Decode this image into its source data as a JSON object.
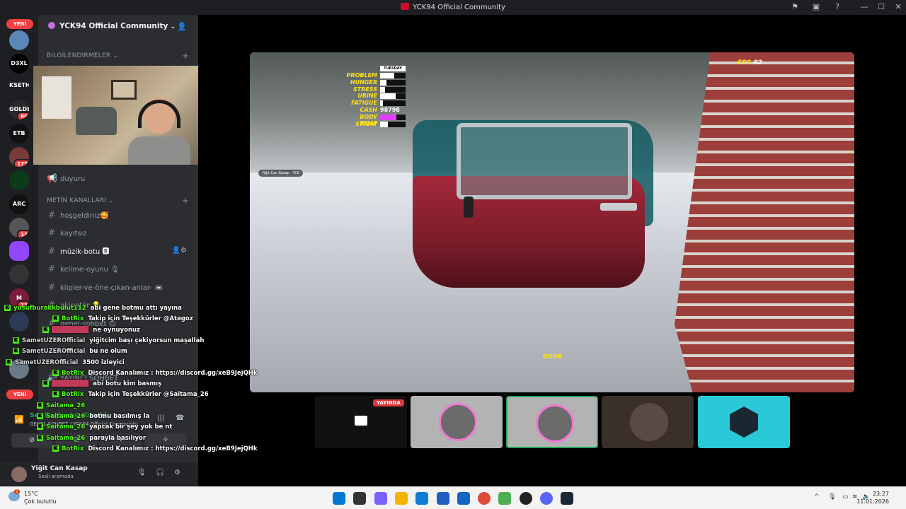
{
  "window": {
    "title": "YCK94 Official Community"
  },
  "rail": {
    "yeni_top": "YENİ",
    "yeni_bottom": "YENİ",
    "servers": [
      {
        "label": "D3XL",
        "badge": ""
      },
      {
        "label": "KSETH",
        "badge": ""
      },
      {
        "label": "GOLDEN",
        "badge": "80"
      },
      {
        "label": "ETB",
        "badge": ""
      },
      {
        "label": "",
        "badge": "177"
      },
      {
        "label": "",
        "badge": ""
      },
      {
        "label": "ARC",
        "badge": ""
      },
      {
        "label": "",
        "badge": "13"
      },
      {
        "label": "",
        "badge": ""
      },
      {
        "label": "",
        "badge": ""
      },
      {
        "label": "M",
        "badge": "13"
      }
    ]
  },
  "server": {
    "name": "YCK94 Official Community",
    "category_notifications": "BİLGİLENDİRMELER",
    "channel_announce": "duyuru",
    "category_text": "METİN KANALLARI",
    "channels": [
      {
        "name": "hoşgeldiniz🥰"
      },
      {
        "name": "kayıtsız"
      },
      {
        "name": "müzik-botu 🅱"
      },
      {
        "name": "kelime-oyunu 🎙"
      },
      {
        "name": "klipler-ve-öne-çıkan-anlar- 📼"
      },
      {
        "name": "akinatör 💡"
      },
      {
        "name": "genel-sohbet 😊"
      }
    ],
    "channel_streamer": "YAYINCI SOHBET"
  },
  "game": {
    "hud": {
      "day": "TUESDAY",
      "labels": [
        "PROBLEM",
        "HUNGER",
        "STRESS",
        "URINE",
        "FATIGUE",
        "CASH",
        "BODY TEMP",
        "SWEAT"
      ],
      "levels": [
        0.55,
        0.25,
        0.2,
        0.6,
        0.12,
        null,
        0.65,
        0.3
      ],
      "cash": "98798"
    },
    "fps_label": "FPS",
    "fps_value": "82",
    "door_label": "DOOR",
    "nametag": "Yiğit Can Kasap · YCK"
  },
  "tiles": {
    "live_label": "YAYINDA"
  },
  "chat": [
    {
      "user": "yusufburakkbulut112",
      "msg": "abi gene botmu attı yayına",
      "color": "green",
      "badge": true
    },
    {
      "user": "BotRix",
      "msg": "Takip için Teşekkürler @Atagoz",
      "color": "green",
      "badge": true
    },
    {
      "user": "████████",
      "msg": "ne oynuyonuz",
      "color": "red",
      "badge": true
    },
    {
      "user": "SametUZEROfficial",
      "msg": "yiğitcim başı çekiyorsun maşallah",
      "color": "gray",
      "badge": true
    },
    {
      "user": "SametUZEROfficial",
      "msg": "bu ne olum",
      "color": "gray",
      "badge": true
    },
    {
      "user": "SametUZEROfficial",
      "msg": "3500 izleyici",
      "color": "gray",
      "badge": true
    },
    {
      "user": "BotRix",
      "msg": "Discord Kanalımız : https://discord.gg/xeB9JejQHk",
      "color": "green",
      "badge": true
    },
    {
      "user": "████████",
      "msg": "abi botu kim basmış",
      "color": "red",
      "badge": true
    },
    {
      "user": "BotRix",
      "msg": "Takip için Teşekkürler @Saitama_26",
      "color": "green",
      "badge": true
    },
    {
      "user": "Saitama_26",
      "msg": "",
      "color": "green",
      "badge": true
    },
    {
      "user": "Saitama_26",
      "msg": "botmu basılmış la",
      "color": "green",
      "badge": true
    },
    {
      "user": "Saitama_26",
      "msg": "yapcak bir şey yok be nt",
      "color": "green",
      "badge": true
    },
    {
      "user": "Saitama_26",
      "msg": "parayla basılıyor",
      "color": "green",
      "badge": true
    },
    {
      "user": "BotRix",
      "msg": "Discord Kanalımız : https://discord.gg/xeB9JejQHk",
      "color": "green",
      "badge": true
    }
  ],
  "voice": {
    "status": "Ses Bağlantısı Kuruldu",
    "subtitle": "GENEL SOHBET / YCK94 Official Community"
  },
  "user_panel": {
    "name": "Yiğit Can Kasap",
    "status": "Sesli aramada"
  },
  "taskbar": {
    "weather_badge": "2",
    "temp": "15°C",
    "condition": "Çok bulutlu",
    "time": "23:27",
    "date": "11.01.2026",
    "app_colors": [
      "#0078d4",
      "#333333",
      "#7b61ff",
      "#f4b400",
      "#0f7bd6",
      "#1f5fbf",
      "#1565c0",
      "#dd4b39",
      "#4caf50",
      "#222222",
      "#5865f2",
      "#1b2838"
    ]
  }
}
